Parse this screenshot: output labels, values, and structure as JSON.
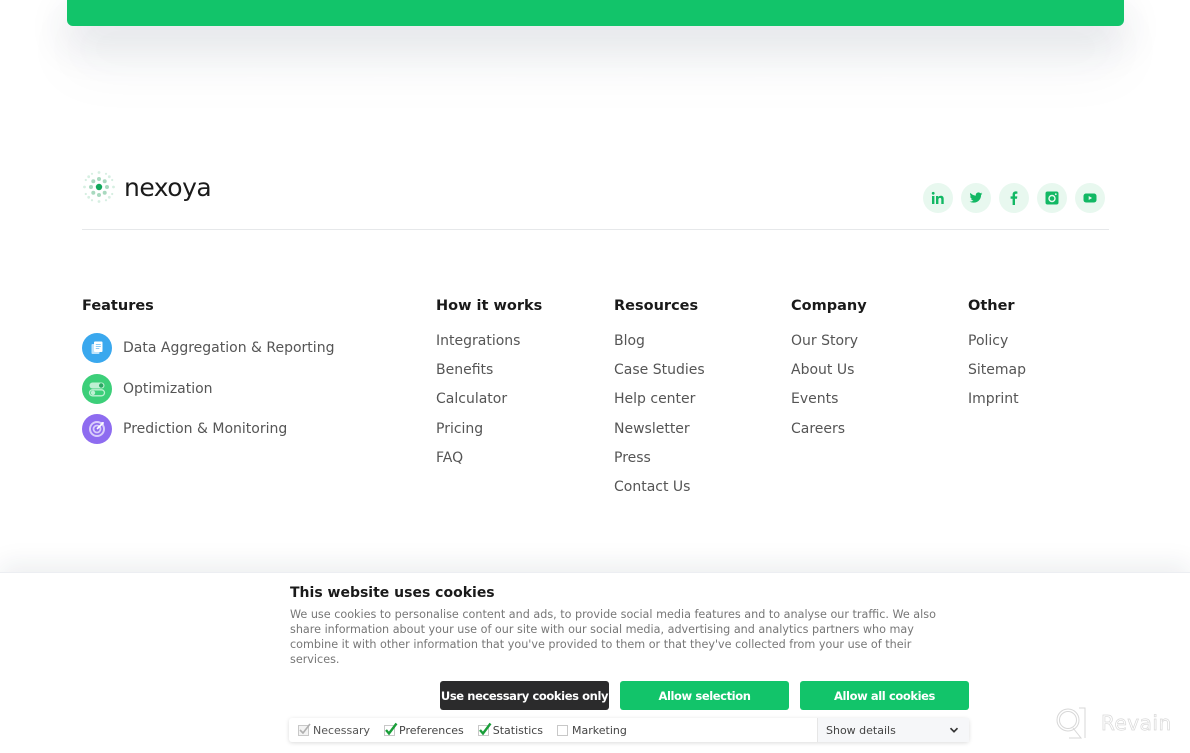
{
  "brand": {
    "name": "nexoya",
    "accent_color": "#12c46a",
    "social_bg": "#e8f8ef"
  },
  "socials": [
    {
      "name": "linkedin",
      "label": "in"
    },
    {
      "name": "twitter",
      "label": "twitter"
    },
    {
      "name": "facebook",
      "label": "f"
    },
    {
      "name": "instagram",
      "label": "instagram"
    },
    {
      "name": "youtube",
      "label": "youtube"
    }
  ],
  "footer": {
    "features": {
      "title": "Features",
      "items": [
        {
          "label": "Data Aggregation & Reporting",
          "icon": "document-icon",
          "color": "#3aa8ee"
        },
        {
          "label": "Optimization",
          "icon": "toggle-icon",
          "color": "#3ccf79"
        },
        {
          "label": "Prediction & Monitoring",
          "icon": "target-icon",
          "color": "#8e6cf0"
        }
      ]
    },
    "how_it_works": {
      "title": "How it works",
      "links": [
        "Integrations",
        "Benefits",
        "Calculator",
        "Pricing",
        "FAQ"
      ]
    },
    "resources": {
      "title": "Resources",
      "links": [
        "Blog",
        "Case Studies",
        "Help center",
        "Newsletter",
        "Press",
        "Contact Us"
      ]
    },
    "company": {
      "title": "Company",
      "links": [
        "Our Story",
        "About Us",
        "Events",
        "Careers"
      ]
    },
    "other": {
      "title": "Other",
      "links": [
        "Policy",
        "Sitemap",
        "Imprint"
      ]
    }
  },
  "cookie_banner": {
    "title": "This website uses cookies",
    "text": "We use cookies to personalise content and ads, to provide social media features and to analyse our traffic. We also share information about your use of our site with our social media, advertising and analytics partners who may combine it with other information that you've provided to them or that they've collected from your use of their services.",
    "buttons": {
      "necessary_only": "Use necessary cookies only",
      "allow_selection": "Allow selection",
      "allow_all": "Allow all cookies"
    },
    "checkboxes": [
      {
        "label": "Necessary",
        "checked": true,
        "disabled": true
      },
      {
        "label": "Preferences",
        "checked": true,
        "disabled": false
      },
      {
        "label": "Statistics",
        "checked": true,
        "disabled": false
      },
      {
        "label": "Marketing",
        "checked": false,
        "disabled": false
      }
    ],
    "show_details": "Show details"
  },
  "watermark": {
    "text": "Revain"
  }
}
